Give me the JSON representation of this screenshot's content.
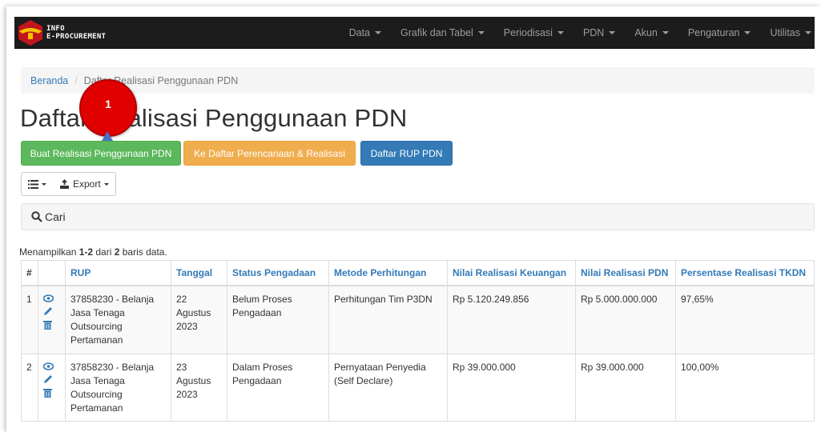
{
  "brand": {
    "line1": "INFO",
    "line2": "E-PROCUREMENT"
  },
  "nav": {
    "items": [
      {
        "label": "Data"
      },
      {
        "label": "Grafik dan Tabel"
      },
      {
        "label": "Periodisasi"
      },
      {
        "label": "PDN"
      },
      {
        "label": "Akun"
      },
      {
        "label": "Pengaturan"
      },
      {
        "label": "Utilitas"
      }
    ]
  },
  "breadcrumb": {
    "home": "Beranda",
    "sep": "/",
    "current": "Daftar Realisasi Penggunaan PDN"
  },
  "page_title": "Daftar Realisasi Penggunaan PDN",
  "buttons": {
    "create": "Buat Realisasi Penggunaan PDN",
    "to_plan": "Ke Daftar Perencanaan & Realisasi",
    "rup_list": "Daftar RUP PDN"
  },
  "toolbar": {
    "export": "Export"
  },
  "search": {
    "label": "Cari"
  },
  "summary": {
    "prefix": "Menampilkan ",
    "range": "1-2",
    "middle": " dari ",
    "total": "2",
    "suffix": " baris data."
  },
  "table": {
    "headers": [
      "#",
      "RUP",
      "Tanggal",
      "Status Pengadaan",
      "Metode Perhitungan",
      "Nilai Realisasi Keuangan",
      "Nilai Realisasi PDN",
      "Persentase Realisasi TKDN"
    ],
    "rows": [
      {
        "no": "1",
        "rup": [
          "37858230 - Belanja",
          "Jasa Tenaga",
          "Outsourcing",
          "Pertamanan"
        ],
        "tanggal": [
          "22",
          "Agustus",
          "2023"
        ],
        "status": [
          "Belum Proses",
          "Pengadaan"
        ],
        "metode": [
          "Perhitungan Tim P3DN"
        ],
        "keuangan": "Rp 5.120.249.856",
        "pdn": "Rp 5.000.000.000",
        "tkdn": "97,65%"
      },
      {
        "no": "2",
        "rup": [
          "37858230 - Belanja",
          "Jasa Tenaga",
          "Outsourcing",
          "Pertamanan"
        ],
        "tanggal": [
          "23",
          "Agustus",
          "2023"
        ],
        "status": [
          "Dalam Proses",
          "Pengadaan"
        ],
        "metode": [
          "Pernyataan Penyedia",
          "(Self Declare)"
        ],
        "keuangan": "Rp 39.000.000",
        "pdn": "Rp 39.000.000",
        "tkdn": "100,00%"
      }
    ]
  },
  "callout": {
    "number": "1"
  },
  "colors": {
    "navbar": "#1c1c1c",
    "link": "#337ab7",
    "success": "#5cb85c",
    "warning": "#f0ad4e",
    "primary": "#337ab7",
    "callout": "#e00000"
  }
}
